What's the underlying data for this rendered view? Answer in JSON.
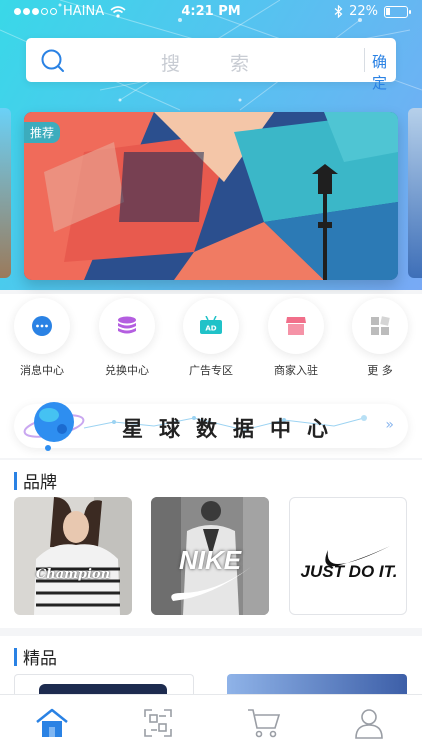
{
  "status_bar": {
    "carrier": "HAINA",
    "time": "4:21 PM",
    "battery": "22%",
    "battery_level": 0.22
  },
  "search": {
    "placeholder": "搜 索",
    "confirm_label": "确定"
  },
  "banner": {
    "tag": "推荐"
  },
  "quick_menu": [
    {
      "label": "消息中心",
      "icon": "message-icon",
      "color": "#2a82e4"
    },
    {
      "label": "兑换中心",
      "icon": "coin-stack-icon",
      "color": "#b45ee0"
    },
    {
      "label": "广告专区",
      "icon": "ad-board-icon",
      "color": "#20c2c8"
    },
    {
      "label": "商家入驻",
      "icon": "shop-icon",
      "color": "#f16f8a"
    },
    {
      "label": "更 多",
      "icon": "more-grid-icon",
      "color": "#bcbcbc"
    }
  ],
  "planet_center": {
    "title": "星球数据中心"
  },
  "sections": {
    "brand": {
      "title": "品牌"
    },
    "featured": {
      "title": "精品"
    }
  },
  "brands": [
    {
      "name": "Champion"
    },
    {
      "name": "NIKE"
    },
    {
      "name": "JUST DO IT."
    }
  ],
  "tabs": [
    {
      "icon": "home-icon",
      "active": true
    },
    {
      "icon": "scan-icon",
      "active": false
    },
    {
      "icon": "cart-icon",
      "active": false
    },
    {
      "icon": "user-icon",
      "active": false
    }
  ],
  "colors": {
    "accent": "#2a82e4",
    "header_start": "#39d8e8",
    "header_end": "#78a9f5"
  }
}
